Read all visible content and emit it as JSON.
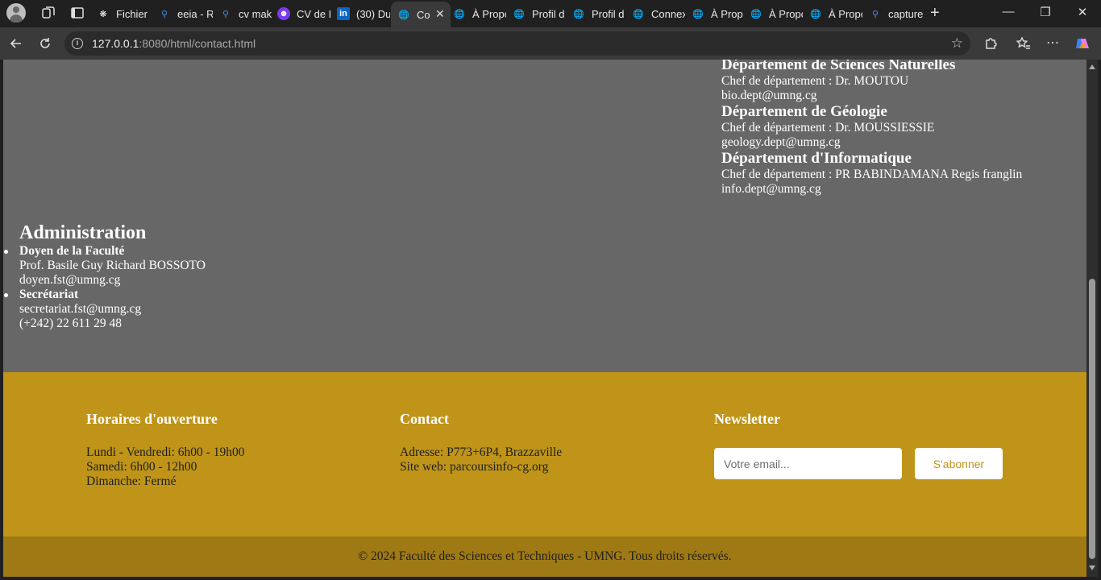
{
  "browser": {
    "tabs": [
      {
        "icon": "chatgpt-icon",
        "label": "Fichier"
      },
      {
        "icon": "search-icon",
        "label": "eeia - R"
      },
      {
        "icon": "search-icon",
        "label": "cv mak"
      },
      {
        "icon": "copilot-icon",
        "label": "CV de D"
      },
      {
        "icon": "linkedin-icon",
        "label": "(30) Du"
      },
      {
        "icon": "globe-icon",
        "label": "Co",
        "active": true
      },
      {
        "icon": "globe-icon",
        "label": "À Propo"
      },
      {
        "icon": "globe-icon",
        "label": "Profil d"
      },
      {
        "icon": "globe-icon",
        "label": "Profil d"
      },
      {
        "icon": "globe-icon",
        "label": "Connex"
      },
      {
        "icon": "globe-icon",
        "label": "À Propo"
      },
      {
        "icon": "globe-icon",
        "label": "À Propo"
      },
      {
        "icon": "globe-icon",
        "label": "À Propo"
      },
      {
        "icon": "search-icon",
        "label": "capture"
      }
    ],
    "url_host": "127.0.0.1",
    "url_rest": ":8080/html/contact.html"
  },
  "departments": [
    {
      "title": "Département de Sciences Naturelles",
      "head": "Chef de département : Dr. MOUTOU",
      "email": "bio.dept@umng.cg"
    },
    {
      "title": "Département de Géologie",
      "head": "Chef de département : Dr. MOUSSIESSIE",
      "email": "geology.dept@umng.cg"
    },
    {
      "title": "Département d'Informatique",
      "head": "Chef de département : PR BABINDAMANA Regis franglin",
      "email": "info.dept@umng.cg"
    }
  ],
  "administration": {
    "title": "Administration",
    "dean_title": "Doyen de la Faculté",
    "dean_name": "Prof. Basile Guy Richard BOSSOTO",
    "dean_email": "doyen.fst@umng.cg",
    "secretariat_title": "Secrétariat",
    "secretariat_email": "secretariat.fst@umng.cg",
    "secretariat_phone": "(+242) 22 611 29 48"
  },
  "footer": {
    "hours_title": "Horaires d'ouverture",
    "hours": [
      "Lundi - Vendredi: 6h00 - 19h00",
      "Samedi: 6h00 - 12h00",
      "Dimanche: Fermé"
    ],
    "contact_title": "Contact",
    "address": "Adresse: P773+6P4, Brazzaville",
    "website": "Site web: parcoursinfo-cg.org",
    "newsletter_title": "Newsletter",
    "email_placeholder": "Votre email...",
    "subscribe_label": "S'abonner",
    "copyright": "© 2024 Faculté des Sciences et Techniques - UMNG. Tous droits réservés."
  },
  "colors": {
    "page_bg": "#676767",
    "footer_bg": "#bf9419",
    "copyright_bg": "#9e7914"
  }
}
